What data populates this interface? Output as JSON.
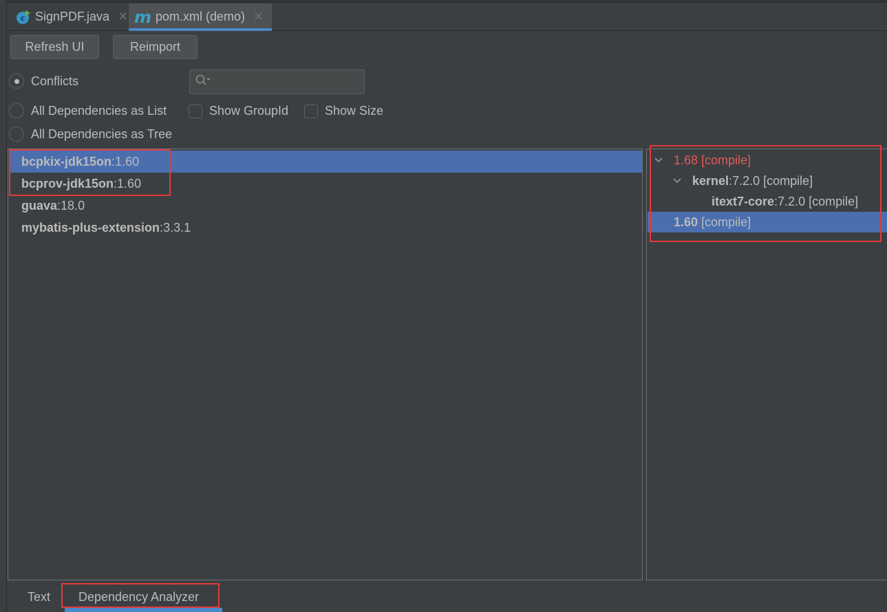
{
  "editor_tabs": [
    {
      "label": "SignPDF.java",
      "icon": "java-class-icon",
      "active": false
    },
    {
      "label": "pom.xml (demo)",
      "icon": "maven-icon",
      "active": true
    }
  ],
  "toolbar": {
    "refresh_label": "Refresh UI",
    "reimport_label": "Reimport"
  },
  "view_modes": [
    {
      "label": "Conflicts",
      "checked": true
    },
    {
      "label": "All Dependencies as List",
      "checked": false
    },
    {
      "label": "All Dependencies as Tree",
      "checked": false
    }
  ],
  "options": {
    "show_groupid_label": "Show GroupId",
    "show_groupid_checked": false,
    "show_size_label": "Show Size",
    "show_size_checked": false
  },
  "search": {
    "value": "",
    "placeholder": ""
  },
  "conflicts_list": [
    {
      "artifact": "bcpkix-jdk15on",
      "sep": " : ",
      "version": "1.60",
      "selected": true
    },
    {
      "artifact": "bcprov-jdk15on",
      "sep": " : ",
      "version": "1.60",
      "selected": false
    },
    {
      "artifact": "guava",
      "sep": " : ",
      "version": "18.0",
      "selected": false
    },
    {
      "artifact": "mybatis-plus-extension",
      "sep": " : ",
      "version": "3.3.1",
      "selected": false
    }
  ],
  "usage_tree": [
    {
      "version": "1.68",
      "scope": "[compile]",
      "conflict": true,
      "expanded": true,
      "level": 0
    },
    {
      "artifact": "kernel",
      "sep": " : ",
      "version": "7.2.0",
      "scope": "[compile]",
      "expanded": true,
      "level": 1
    },
    {
      "artifact": "itext7-core",
      "sep": " : ",
      "version": "7.2.0",
      "scope": "[compile]",
      "level": 2
    },
    {
      "version": "1.60",
      "scope": "[compile]",
      "selected": true,
      "level": 0
    }
  ],
  "bottom_tabs": [
    {
      "label": "Text",
      "active": false
    },
    {
      "label": "Dependency Analyzer",
      "active": true
    }
  ],
  "colors": {
    "background": "#3c3f41",
    "selection": "#4b6eaf",
    "accent": "#4a88c7",
    "conflict": "#e35959",
    "annotation": "#e5393a"
  }
}
